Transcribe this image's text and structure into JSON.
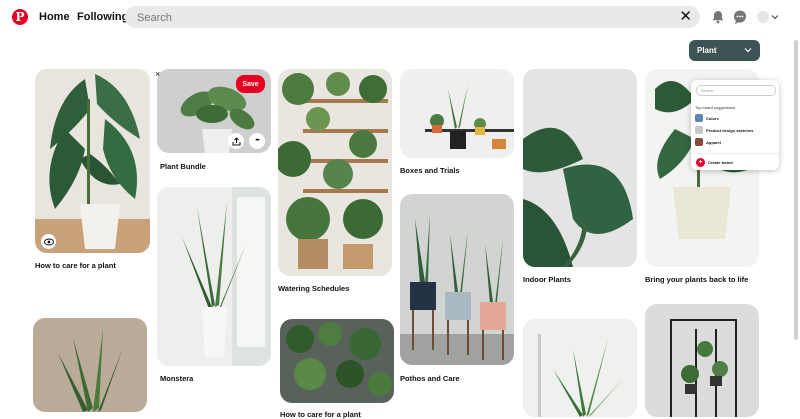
{
  "header": {
    "logo_letter": "P",
    "nav": [
      "Home",
      "Following"
    ],
    "search_placeholder": "Search",
    "clear_symbol": "✕",
    "icons": [
      "bell-icon",
      "chat-icon",
      "avatar",
      "chevron-down-icon"
    ]
  },
  "board_select": {
    "label": "Plant",
    "caret": "⌄"
  },
  "pin_overlay": {
    "close": "×",
    "save_label": "Save",
    "share": "share-icon",
    "more": "•••",
    "visibility": "eye-icon"
  },
  "pins": [
    {
      "title": "How to care for a plant"
    },
    {
      "title": "Plant Bundle"
    },
    {
      "title": "Monstera"
    },
    {
      "title": "Watering Schedules"
    },
    {
      "title": "How to care for a plant"
    },
    {
      "title": "Boxes and Trials"
    },
    {
      "title": "Pothos and Care"
    },
    {
      "title": "Indoor Plants"
    },
    {
      "title": "Bring your plants back to life"
    }
  ],
  "board_dropdown": {
    "search_placeholder": "Search",
    "heading": "Top board suggestions",
    "boards": [
      {
        "name": "Colors",
        "color": "#5b86b3"
      },
      {
        "name": "Product design sketches",
        "color": "#c9c9c9"
      },
      {
        "name": "Apparel",
        "color": "#8a4a3c"
      }
    ],
    "create_label": "Create board",
    "create_icon": "+"
  },
  "colors": {
    "brand_red": "#e60023",
    "board_button": "#3d5454",
    "search_bg": "#e9e9e9"
  }
}
